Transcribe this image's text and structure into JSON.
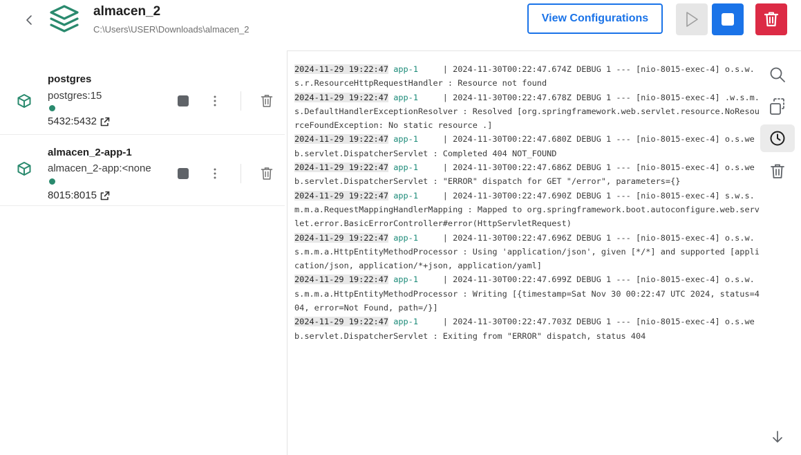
{
  "header": {
    "title": "almacen_2",
    "path": "C:\\Users\\USER\\Downloads\\almacen_2",
    "view_config_label": "View Configurations"
  },
  "containers": [
    {
      "name": "postgres",
      "image": "postgres:15",
      "ports": "5432:5432",
      "status_color": "#2a8a6e"
    },
    {
      "name": "almacen_2-app-1",
      "image": "almacen_2-app:<none",
      "ports": "8015:8015",
      "status_color": "#2a8a6e"
    }
  ],
  "logs": [
    {
      "ts": "2024-11-29 19:22:47",
      "svc": "app-1",
      "gap": "     ",
      "msg": "| 2024-11-30T00:22:47.674Z DEBUG 1 --- [nio-8015-exec-4] o.s.w.s.r.ResourceHttpRequestHandler     : Resource not found"
    },
    {
      "ts": "2024-11-29 19:22:47",
      "svc": "app-1",
      "gap": "     ",
      "msg": "| 2024-11-30T00:22:47.678Z DEBUG 1 --- [nio-8015-exec-4] .w.s.m.s.DefaultHandlerExceptionResolver : Resolved [org.springframework.web.servlet.resource.NoResourceFoundException: No static resource .]"
    },
    {
      "ts": "2024-11-29 19:22:47",
      "svc": "app-1",
      "gap": "     ",
      "msg": "| 2024-11-30T00:22:47.680Z DEBUG 1 --- [nio-8015-exec-4] o.s.web.servlet.DispatcherServlet        : Completed 404 NOT_FOUND"
    },
    {
      "ts": "2024-11-29 19:22:47",
      "svc": "app-1",
      "gap": "     ",
      "msg": "| 2024-11-30T00:22:47.686Z DEBUG 1 --- [nio-8015-exec-4] o.s.web.servlet.DispatcherServlet        : \"ERROR\" dispatch for GET \"/error\", parameters={}"
    },
    {
      "ts": "2024-11-29 19:22:47",
      "svc": "app-1",
      "gap": "     ",
      "msg": "| 2024-11-30T00:22:47.690Z DEBUG 1 --- [nio-8015-exec-4] s.w.s.m.m.a.RequestMappingHandlerMapping : Mapped to org.springframework.boot.autoconfigure.web.servlet.error.BasicErrorController#error(HttpServletRequest)"
    },
    {
      "ts": "2024-11-29 19:22:47",
      "svc": "app-1",
      "gap": "     ",
      "msg": "| 2024-11-30T00:22:47.696Z DEBUG 1 --- [nio-8015-exec-4] o.s.w.s.m.m.a.HttpEntityMethodProcessor  : Using 'application/json', given [*/*] and supported [application/json, application/*+json, application/yaml]"
    },
    {
      "ts": "2024-11-29 19:22:47",
      "svc": "app-1",
      "gap": "     ",
      "msg": "| 2024-11-30T00:22:47.699Z DEBUG 1 --- [nio-8015-exec-4] o.s.w.s.m.m.a.HttpEntityMethodProcessor  : Writing [{timestamp=Sat Nov 30 00:22:47 UTC 2024, status=404, error=Not Found, path=/}]"
    },
    {
      "ts": "2024-11-29 19:22:47",
      "svc": "app-1",
      "gap": "     ",
      "msg": "| 2024-11-30T00:22:47.703Z DEBUG 1 --- [nio-8015-exec-4] o.s.web.servlet.DispatcherServlet        : Exiting from \"ERROR\" dispatch, status 404"
    }
  ],
  "icons": {
    "back": "chevron-left-icon",
    "app": "stack-layers-icon",
    "play": "play-icon",
    "stop": "stop-icon",
    "delete": "trash-icon",
    "container": "cube-icon",
    "search": "search-icon",
    "copy": "copy-icon",
    "timestamps": "clock-icon",
    "clear": "trash-icon",
    "scroll": "arrow-down-icon"
  },
  "colors": {
    "accent": "#1a73e8",
    "danger": "#dc2b45",
    "running": "#2a8a6e",
    "service": "#1b8a78"
  }
}
